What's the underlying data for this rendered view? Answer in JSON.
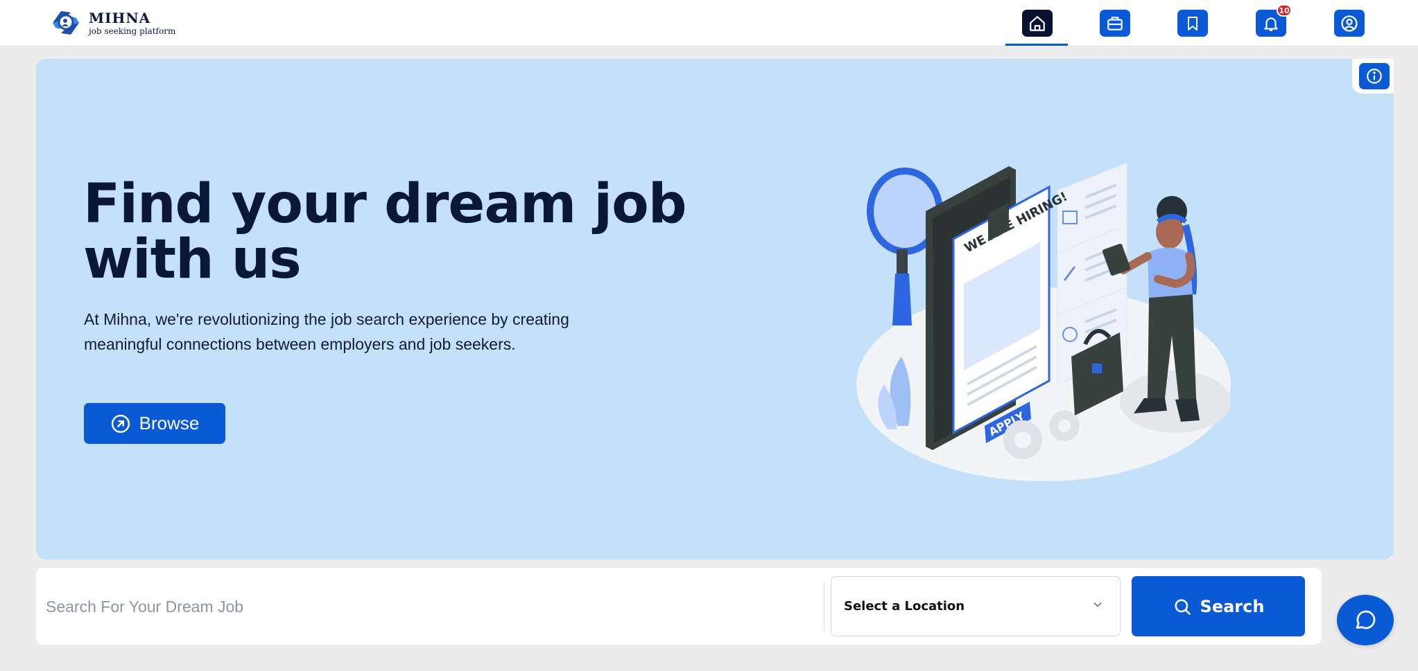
{
  "brand": {
    "name": "MIHNA",
    "tagline": "job seeking platform"
  },
  "nav": {
    "items": [
      {
        "name": "home",
        "icon": "home-icon",
        "active": true
      },
      {
        "name": "jobs",
        "icon": "briefcase-icon",
        "active": false
      },
      {
        "name": "saved",
        "icon": "bookmark-icon",
        "active": false
      },
      {
        "name": "notifications",
        "icon": "bell-icon",
        "active": false,
        "badge": "10"
      },
      {
        "name": "profile",
        "icon": "user-circle-icon",
        "active": false
      }
    ]
  },
  "hero": {
    "title_line1": "Find your dream job",
    "title_line2": "with us",
    "description": "At Mihna, we're revolutionizing the job search experience by creating meaningful connections between employers and job seekers.",
    "browse_label": "Browse",
    "illustration": {
      "headline": "WE ARE HIRING!",
      "button": "APPLY"
    }
  },
  "search": {
    "placeholder": "Search For Your Dream Job",
    "location_label": "Select a Location",
    "button_label": "Search"
  },
  "colors": {
    "primary": "#0a5ad6",
    "dark": "#0b1230",
    "hero_bg": "#c5e1f9",
    "page_bg": "#ececec",
    "badge": "#d71f26"
  }
}
